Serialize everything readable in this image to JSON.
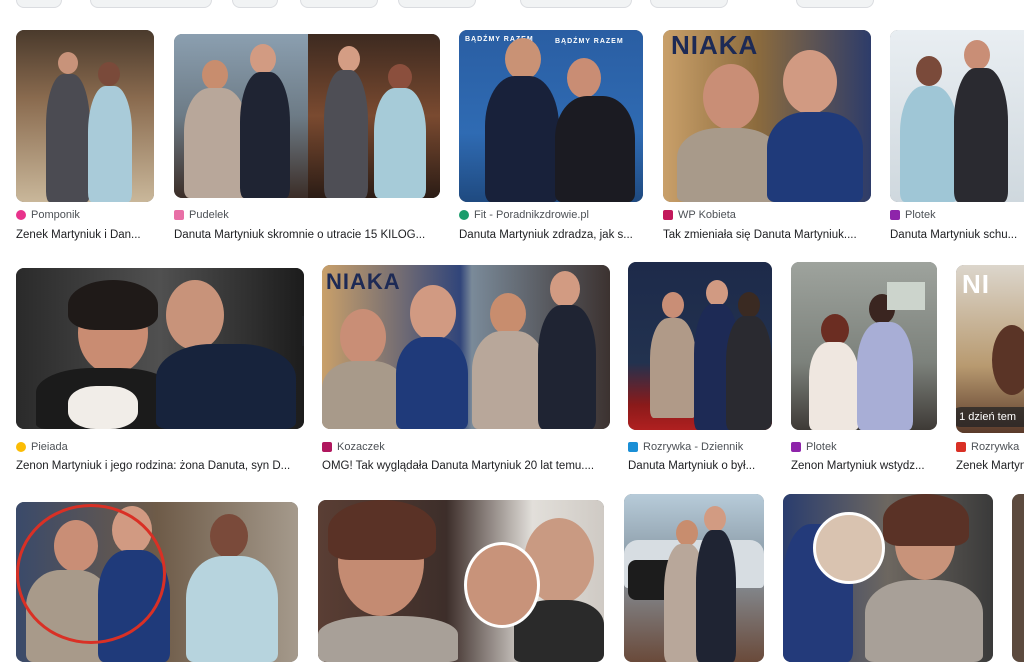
{
  "results": [
    {
      "source": "Pomponik",
      "title": "Zenek Martyniuk i Dan...",
      "favicon_color": "#e8338c"
    },
    {
      "source": "Pudelek",
      "title": "Danuta Martyniuk skromnie o utracie 15 KILOG...",
      "favicon_color": "#e86fa6"
    },
    {
      "source": "Fit - Poradnikzdrowie.pl",
      "title": "Danuta Martyniuk zdradza, jak s...",
      "favicon_color": "#1a9c6b"
    },
    {
      "source": "WP Kobieta",
      "title": "Tak zmieniała się Danuta Martyniuk....",
      "favicon_color": "#c2185b"
    },
    {
      "source": "Plotek",
      "title": "Danuta Martyniuk schu...",
      "favicon_color": "#8e24aa"
    },
    {
      "source": "Pieiada",
      "title": "Zenon Martyniuk i jego rodzina: żona Danuta, syn D...",
      "favicon_color": "#fbbc04"
    },
    {
      "source": "Kozaczek",
      "title": "OMG! Tak wyglądała Danuta Martyniuk 20 lat temu....",
      "favicon_color": "#b0175e"
    },
    {
      "source": "Rozrywka - Dziennik",
      "title": "Danuta Martyniuk o był...",
      "favicon_color": "#1a8fd6"
    },
    {
      "source": "Plotek",
      "title": "Zenon Martyniuk wstydz...",
      "favicon_color": "#8e24aa"
    },
    {
      "source": "Rozrywka",
      "title": "Zenek Martyn",
      "favicon_color": "#d93025",
      "badge": "1 dzień tem"
    }
  ],
  "image_text": {
    "niaka_1": "NIAKA",
    "niaka_2": "NIAKA",
    "niaka_3": "NI",
    "bądźmy_razem": "BĄDŹMY RAZEM"
  }
}
